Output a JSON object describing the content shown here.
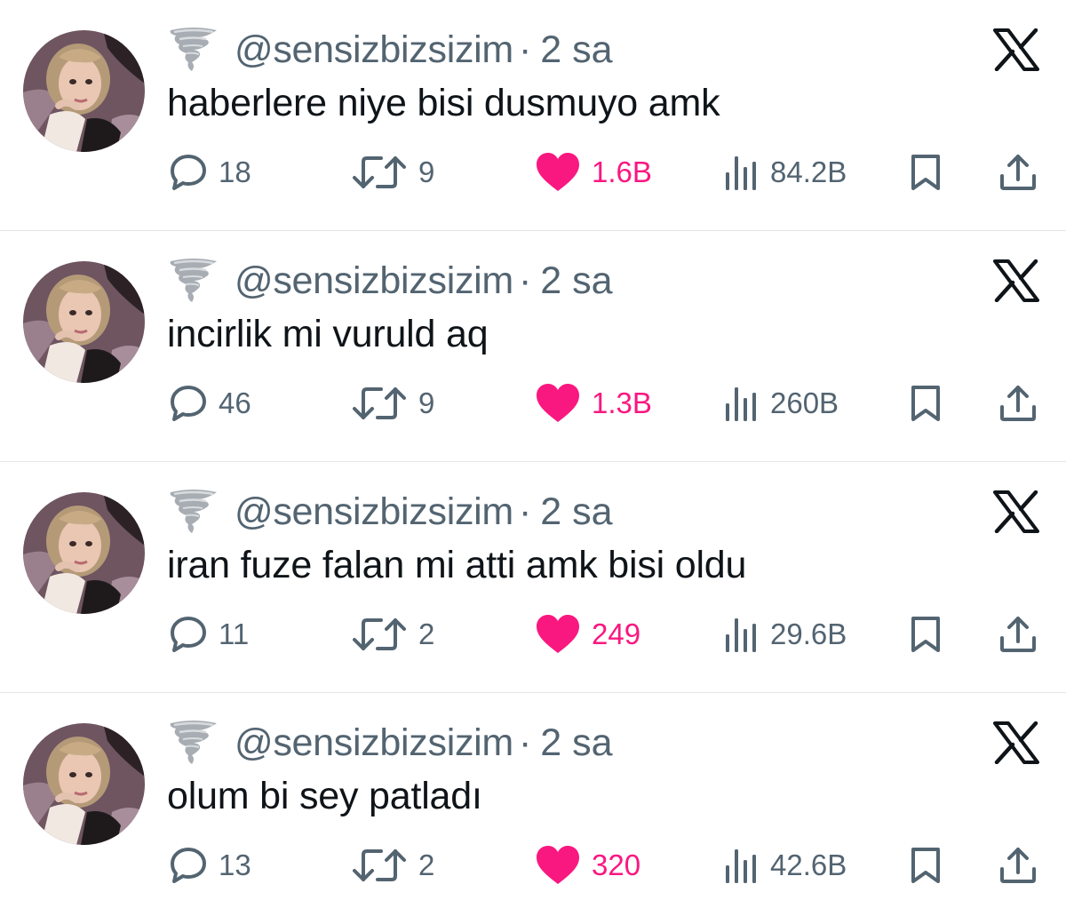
{
  "colors": {
    "secondary_text": "#536471",
    "primary_text": "#0f1419",
    "like_pink": "#f91880",
    "divider": "#e3e6e8"
  },
  "icons": {
    "reply": "speech-bubble-icon",
    "retweet": "retweet-arrows-icon",
    "like": "heart-filled-icon",
    "views": "bar-chart-icon",
    "bookmark": "bookmark-icon",
    "share": "share-upload-icon",
    "brand": "x-logo-icon",
    "handle_emoji": "tornado-emoji"
  },
  "tweets": [
    {
      "handle": "@sensizbizsizim",
      "separator": "·",
      "time": "2 sa",
      "text": "haberlere niye bisi dusmuyo amk",
      "replies": "18",
      "retweets": "9",
      "likes": "1.6B",
      "views": "84.2B"
    },
    {
      "handle": "@sensizbizsizim",
      "separator": "·",
      "time": "2 sa",
      "text": "incirlik mi vuruld aq",
      "replies": "46",
      "retweets": "9",
      "likes": "1.3B",
      "views": "260B"
    },
    {
      "handle": "@sensizbizsizim",
      "separator": "·",
      "time": "2 sa",
      "text": "iran fuze falan mi atti amk bisi oldu",
      "replies": "11",
      "retweets": "2",
      "likes": "249",
      "views": "29.6B"
    },
    {
      "handle": "@sensizbizsizim",
      "separator": "·",
      "time": "2 sa",
      "text": "olum bi sey patladı",
      "replies": "13",
      "retweets": "2",
      "likes": "320",
      "views": "42.6B"
    }
  ]
}
